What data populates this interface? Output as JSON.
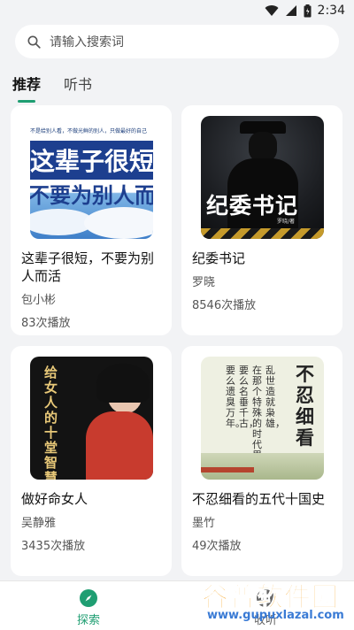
{
  "status": {
    "time": "2:34"
  },
  "search": {
    "placeholder": "请输入搜索词"
  },
  "tabs": [
    {
      "label": "推荐"
    },
    {
      "label": "听书"
    }
  ],
  "books": [
    {
      "title": "这辈子很短，不要为别人而活",
      "author": "包小彬",
      "plays": "83次播放",
      "cover": {
        "line1": "这辈子很短",
        "line2": "不要为别人而活",
        "top": "不是给别人看，不做光鲜的别人，只做最好的自己"
      }
    },
    {
      "title": "纪委书记",
      "author": "罗晓",
      "plays": "8546次播放",
      "cover": {
        "title": "纪委书记",
        "byline": "罗晓/著"
      }
    },
    {
      "title": "做好命女人",
      "author": "吴静雅",
      "plays": "3435次播放",
      "cover": {
        "title": "给女人的十堂智慧课"
      }
    },
    {
      "title": "不忍细看的五代十国史",
      "author": "墨竹",
      "plays": "49次播放",
      "cover": {
        "big": "不忍细看",
        "poem": [
          "乱世造就枭雄，",
          "在那个特殊的时代里，",
          "要么名垂千古，",
          "要么遗臭万年。"
        ]
      }
    }
  ],
  "nav": [
    {
      "label": "探索",
      "icon": "compass-icon"
    },
    {
      "label": "收听",
      "icon": "audio-wave-icon"
    }
  ],
  "watermark": {
    "text": "谷普软件园",
    "url": "www.gupuxlazal.com"
  },
  "colors": {
    "accent": "#1f9e72",
    "background": "#f2f3f5"
  }
}
